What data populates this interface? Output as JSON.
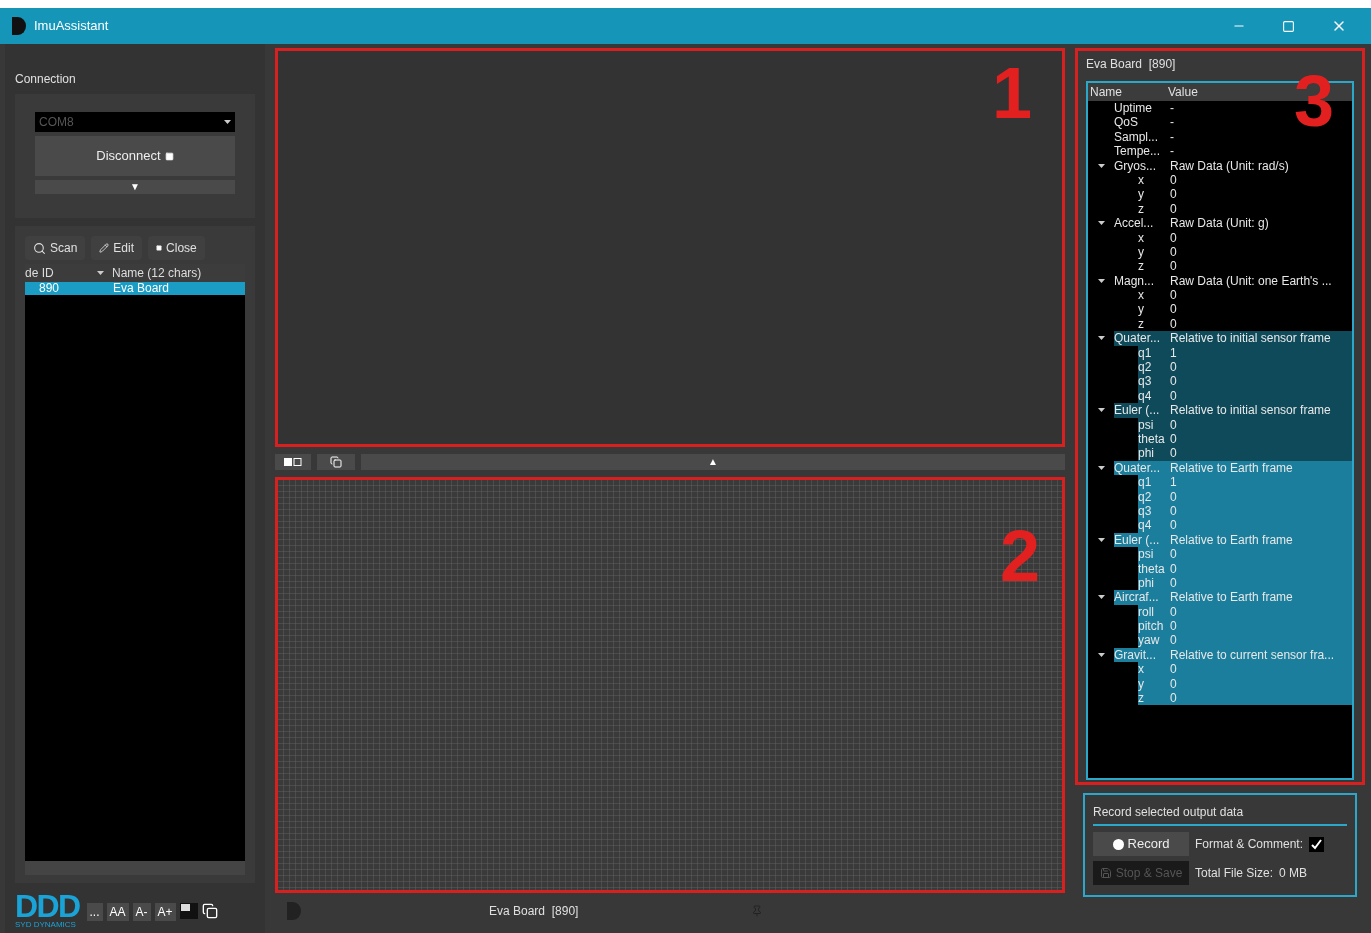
{
  "window": {
    "title": "ImuAssistant"
  },
  "connection": {
    "title": "Connection",
    "port": "COM8",
    "connect_button": "Disconnect",
    "expand_button": "▼"
  },
  "nodes": {
    "buttons": [
      {
        "label": "Scan",
        "kind": "search"
      },
      {
        "label": "Edit",
        "kind": "edit"
      },
      {
        "label": "Close",
        "kind": "close"
      }
    ],
    "columns": [
      "de ID",
      "Name  (12 chars)"
    ],
    "rows": [
      {
        "id": "890",
        "name": "Eva Board",
        "selected": true
      }
    ]
  },
  "footer_left": {
    "logo": "DDD",
    "logo_sub": "SYD DYNAMICS",
    "buttons": [
      "...",
      "AA",
      "A-",
      "A+"
    ]
  },
  "panels": [
    {
      "number": "1"
    },
    {
      "number": "2"
    }
  ],
  "splitter": {
    "arrow": "▲"
  },
  "status_bar": {
    "title": "Eva Board  [890]"
  },
  "board": {
    "title": "Eva Board  [890]",
    "number": "3",
    "columns": [
      "Name",
      "Value"
    ],
    "items": [
      {
        "name": "Uptime",
        "value": "-",
        "selected": false
      },
      {
        "name": "QoS",
        "value": "-",
        "selected": false
      },
      {
        "name": "Sampl...",
        "value": "-",
        "selected": false
      },
      {
        "name": "Tempe...",
        "value": "-",
        "selected": false
      },
      {
        "name": "Gryos...",
        "value": "Raw Data (Unit: rad/s)",
        "selected": false,
        "expanded": true,
        "children": [
          {
            "name": "x",
            "value": "0"
          },
          {
            "name": "y",
            "value": "0"
          },
          {
            "name": "z",
            "value": "0"
          }
        ]
      },
      {
        "name": "Accel...",
        "value": "Raw Data (Unit: g)",
        "selected": false,
        "expanded": true,
        "children": [
          {
            "name": "x",
            "value": "0"
          },
          {
            "name": "y",
            "value": "0"
          },
          {
            "name": "z",
            "value": "0"
          }
        ]
      },
      {
        "name": "Magn...",
        "value": "Raw Data (Unit: one Earth's ...",
        "selected": false,
        "expanded": true,
        "children": [
          {
            "name": "x",
            "value": "0"
          },
          {
            "name": "y",
            "value": "0"
          },
          {
            "name": "z",
            "value": "0"
          }
        ]
      },
      {
        "name": "Quater...",
        "value": "Relative to initial sensor frame",
        "selected": true,
        "focused": false,
        "expanded": true,
        "children": [
          {
            "name": "q1",
            "value": "1"
          },
          {
            "name": "q2",
            "value": "0"
          },
          {
            "name": "q3",
            "value": "0"
          },
          {
            "name": "q4",
            "value": "0"
          }
        ]
      },
      {
        "name": "Euler (...",
        "value": "Relative to initial sensor frame",
        "selected": true,
        "focused": false,
        "expanded": true,
        "children": [
          {
            "name": "psi",
            "value": "0"
          },
          {
            "name": "theta",
            "value": "0"
          },
          {
            "name": "phi",
            "value": "0"
          }
        ]
      },
      {
        "name": "Quater...",
        "value": "Relative to Earth frame",
        "selected": true,
        "focused": true,
        "expanded": true,
        "children": [
          {
            "name": "q1",
            "value": "1"
          },
          {
            "name": "q2",
            "value": "0"
          },
          {
            "name": "q3",
            "value": "0"
          },
          {
            "name": "q4",
            "value": "0"
          }
        ]
      },
      {
        "name": "Euler (...",
        "value": "Relative to Earth frame",
        "selected": true,
        "focused": true,
        "expanded": true,
        "children": [
          {
            "name": "psi",
            "value": "0"
          },
          {
            "name": "theta",
            "value": "0"
          },
          {
            "name": "phi",
            "value": "0"
          }
        ]
      },
      {
        "name": "Aircraf...",
        "value": "Relative to Earth frame",
        "selected": true,
        "focused": true,
        "expanded": true,
        "children": [
          {
            "name": "roll",
            "value": "0"
          },
          {
            "name": "pitch",
            "value": "0"
          },
          {
            "name": "yaw",
            "value": "0"
          }
        ]
      },
      {
        "name": "Gravit...",
        "value": "Relative to current sensor fra...",
        "selected": true,
        "focused": true,
        "expanded": true,
        "children": [
          {
            "name": "x",
            "value": "0"
          },
          {
            "name": "y",
            "value": "0"
          },
          {
            "name": "z",
            "value": "0"
          }
        ]
      }
    ]
  },
  "record": {
    "title": "Record selected output data",
    "record_button": "Record",
    "stop_button": "Stop & Save",
    "stop_disabled": true,
    "format_label": "Format & Comment:",
    "format_checked": true,
    "size_label": "Total File Size:",
    "size_value": "0 MB"
  }
}
